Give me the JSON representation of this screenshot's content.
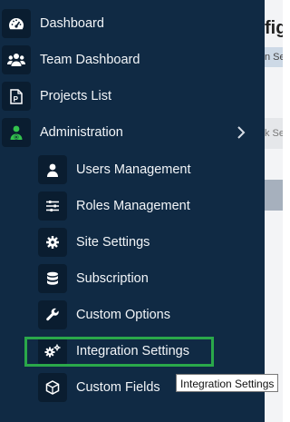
{
  "sidebar": {
    "items": [
      {
        "label": "Dashboard",
        "icon": "speedometer-icon"
      },
      {
        "label": "Team Dashboard",
        "icon": "users-group-icon"
      },
      {
        "label": "Projects List",
        "icon": "project-file-icon"
      },
      {
        "label": "Administration",
        "icon": "admin-user-cog-icon",
        "expanded": true
      }
    ],
    "admin_items": [
      {
        "label": "Users Management",
        "icon": "user-icon"
      },
      {
        "label": "Roles Management",
        "icon": "sliders-icon"
      },
      {
        "label": "Site Settings",
        "icon": "gear-icon"
      },
      {
        "label": "Subscription",
        "icon": "database-icon"
      },
      {
        "label": "Custom Options",
        "icon": "wrench-icon"
      },
      {
        "label": "Integration Settings",
        "icon": "gears-icon",
        "highlighted": true
      },
      {
        "label": "Custom Fields",
        "icon": "cube-icon"
      }
    ]
  },
  "tooltip": {
    "text": "Integration Settings"
  },
  "background": {
    "title": "figu",
    "strip_text": "n Se",
    "input_text": "k Se"
  },
  "colors": {
    "sidebar_bg": "#102a44",
    "icon_box_bg": "#0a1d30",
    "highlight": "#2aa84a",
    "admin_icon": "#33c24d"
  }
}
